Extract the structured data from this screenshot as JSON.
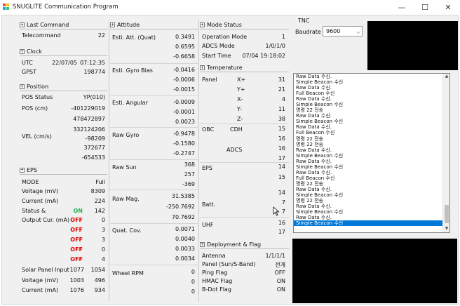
{
  "window": {
    "title": "SNUGLITE Communication Program",
    "minimize": "—",
    "maximize": "☐",
    "close": "✕"
  },
  "last_command": {
    "header": "Last Command",
    "label": "Telecommand",
    "value": "22"
  },
  "clock": {
    "header": "Clock",
    "utc_label": "UTC",
    "utc_date": "22/07/05",
    "utc_time": "07:12:35",
    "gpst_label": "GPST",
    "gpst_value": "198774"
  },
  "position": {
    "header": "Position",
    "status_label": "POS Status",
    "status_value": "YP(010)",
    "pos_label": "POS (cm)",
    "pos_values": [
      "-401229019",
      "478472897",
      "332124206"
    ],
    "vel_label": "VEL (cm/s)",
    "vel_values": [
      "-98209",
      "372677",
      "-654533"
    ]
  },
  "eps": {
    "header": "EPS",
    "mode_label": "MODE",
    "mode_value": "Full",
    "voltage_label": "Voltage (mV)",
    "voltage_value": "8309",
    "current_label": "Current (mA)",
    "current_value": "224",
    "status_label": "Status &",
    "output_label": "Output Cur. (mA)",
    "outputs": [
      {
        "state": "ON",
        "value": "142"
      },
      {
        "state": "OFF",
        "value": "0"
      },
      {
        "state": "OFF",
        "value": "3"
      },
      {
        "state": "OFF",
        "value": "3"
      },
      {
        "state": "OFF",
        "value": "0"
      },
      {
        "state": "OFF",
        "value": "4"
      }
    ],
    "solar_label": "Solar Panel Input",
    "solar_values": [
      "1077",
      "1054"
    ],
    "solar_v_label": "Voltage (mV)",
    "solar_v_values": [
      "1003",
      "496"
    ],
    "solar_c_label": "Current (mA)",
    "solar_c_values": [
      "1076",
      "934"
    ]
  },
  "attitude": {
    "header": "Attitude",
    "quat_label": "Esti. Att. (Quat)",
    "quat_values": [
      "0.3491",
      "0.6595",
      "-0.6658"
    ],
    "bias_label": "Esti. Gyro Bias",
    "bias_values": [
      "-0.0416",
      "-0.0006",
      "-0.0015"
    ],
    "ang_label": "Esti. Angular",
    "ang_values": [
      "-0.0009",
      "-0.0001",
      "0.0023"
    ],
    "gyro_label": "Raw Gyro",
    "gyro_values": [
      "-0.9478",
      "-0.1580",
      "-0.2747"
    ],
    "sun_label": "Raw Sun",
    "sun_values": [
      "368",
      "257",
      "-369"
    ],
    "mag_label": "Raw Mag.",
    "mag_values": [
      "31.5385",
      "-250.7692",
      "70.7692"
    ],
    "cov_label": "Quat. Cov.",
    "cov_values": [
      "0.0071",
      "0.0040",
      "0.0033",
      "0.0034"
    ],
    "rpm_label": "Wheel RPM",
    "rpm_values": [
      "0",
      "0",
      "0"
    ]
  },
  "mode_status": {
    "header": "Mode Status",
    "op_label": "Operation Mode",
    "op_value": "1",
    "adcs_label": "ADCS Mode",
    "adcs_value": "1/0/1/0",
    "start_label": "Start Time",
    "start_value": "07/04 19:18:02"
  },
  "temperature": {
    "header": "Temperature",
    "panel_label": "Panel",
    "panel_rows": [
      {
        "axis": "X+",
        "value": "31"
      },
      {
        "axis": "Y+",
        "value": "21"
      },
      {
        "axis": "X-",
        "value": "4"
      },
      {
        "axis": "Y-",
        "value": "11"
      },
      {
        "axis": "Z-",
        "value": "38"
      }
    ],
    "obc_label": "OBC",
    "cdh_label": "CDH",
    "cdh_values": [
      "15",
      "16"
    ],
    "adcs_label": "ADCS",
    "adcs_values": [
      "16",
      "17"
    ],
    "eps_label": "EPS",
    "eps_values": [
      "14",
      "15",
      "14"
    ],
    "batt_label": "Batt.",
    "batt_values": [
      "7",
      "7"
    ],
    "uhf_label": "UHF",
    "uhf_values": [
      "16",
      "17"
    ]
  },
  "deploy": {
    "header": "Deployment & Flag",
    "antenna_label": "Antenna",
    "antenna_value": "1/1/1/1",
    "panel_label": "Panel (Sun/S-Band)",
    "panel_value": "전개",
    "ping_label": "Ping Flag",
    "ping_value": "OFF",
    "hmac_label": "HMAC Flag",
    "hmac_value": "ON",
    "bdot_label": "B-Dot Flag",
    "bdot_value": "ON"
  },
  "tnc": {
    "label": "TNC",
    "baudrate_label": "Baudrate",
    "baudrate_value": "9600"
  },
  "log": {
    "items": [
      "Raw Data 수신.",
      "Simple Beacon 수신",
      "Raw Data 수신.",
      "Full Beacon 수신",
      "Raw Data 수신.",
      "Simple Beacon 수신",
      "명령 22 전송",
      "Raw Data 수신.",
      "Simple Beacon 수신",
      "Raw Data 수신.",
      "Full Beacon 수신",
      "명령 22 전송",
      "명령 22 전송",
      "Raw Data 수신.",
      "Simple Beacon 수신",
      "Raw Data 수신.",
      "Simple Beacon 수신",
      "Raw Data 수신.",
      "Full Beacon 수신",
      "명령 22 전송",
      "Raw Data 수신.",
      "Simple Beacon 수신",
      "명령 22 전송",
      "Raw Data 수신.",
      "Simple Beacon 수신",
      "Raw Data 수신.",
      "Simple Beacon 수신"
    ],
    "selected_index": 26
  },
  "colors": {
    "on": "#22b14c",
    "off": "#e60000",
    "selection": "#0078d7",
    "redaction": "#000000"
  }
}
